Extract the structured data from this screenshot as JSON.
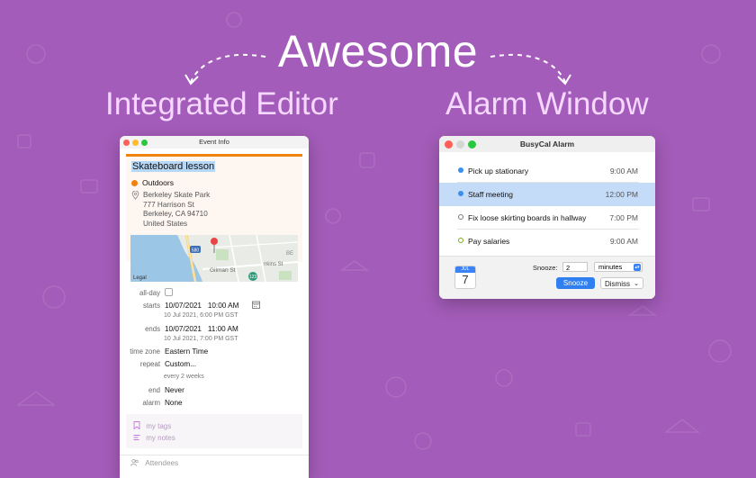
{
  "hero": {
    "headline": "Awesome",
    "left_caption": "Integrated Editor",
    "right_caption": "Alarm Window"
  },
  "colors": {
    "background": "#a35cb9",
    "calendar_orange": "#f0820f",
    "accent_blue": "#2f7ff0",
    "selection_blue": "#c5dcf8"
  },
  "event_window": {
    "title": "Event Info",
    "event_title": "Skateboard lesson",
    "calendar": "Outdoors",
    "location_lines": [
      "Berkeley Skate Park",
      "777 Harrison St",
      "Berkeley, CA  94710",
      "United States"
    ],
    "map": {
      "legal": "Legal",
      "street1": "Gilman St",
      "route1": "580",
      "route2": "123",
      "partial1": "nkins St",
      "partial2": "BE"
    },
    "fields": {
      "allday_label": "all-day",
      "starts_label": "starts",
      "starts_date": "10/07/2021",
      "starts_time": "10:00 AM",
      "starts_sub": "10 Jul 2021, 6:00 PM GST",
      "ends_label": "ends",
      "ends_date": "10/07/2021",
      "ends_time": "11:00 AM",
      "ends_sub": "10 Jul 2021, 7:00 PM GST",
      "timezone_label": "time zone",
      "timezone_value": "Eastern Time",
      "repeat_label": "repeat",
      "repeat_value": "Custom...",
      "repeat_sub": "every 2 weeks",
      "end_label": "end",
      "end_value": "Never",
      "alarm_label": "alarm",
      "alarm_value": "None"
    },
    "tags_placeholder": "my tags",
    "notes_placeholder": "my notes",
    "attendees_placeholder": "Attendees"
  },
  "alarm_window": {
    "title": "BusyCal Alarm",
    "items": [
      {
        "name": "Pick up stationary",
        "time": "9:00 AM",
        "dot": "#3b8ff0",
        "ring": false
      },
      {
        "name": "Staff meeting",
        "time": "12:00 PM",
        "dot": "#3b8ff0",
        "ring": false
      },
      {
        "name": "Fix loose skirting boards in hallway",
        "time": "7:00 PM",
        "dot": "#777777",
        "ring": true
      },
      {
        "name": "Pay salaries",
        "time": "9:00 AM",
        "dot": "#7cab1a",
        "ring": true
      }
    ],
    "calendar_icon": {
      "month": "JUL",
      "day": "7"
    },
    "snooze_label": "Snooze:",
    "snooze_value": "2",
    "snooze_unit": "minutes",
    "snooze_button": "Snooze",
    "dismiss_button": "Dismiss"
  }
}
